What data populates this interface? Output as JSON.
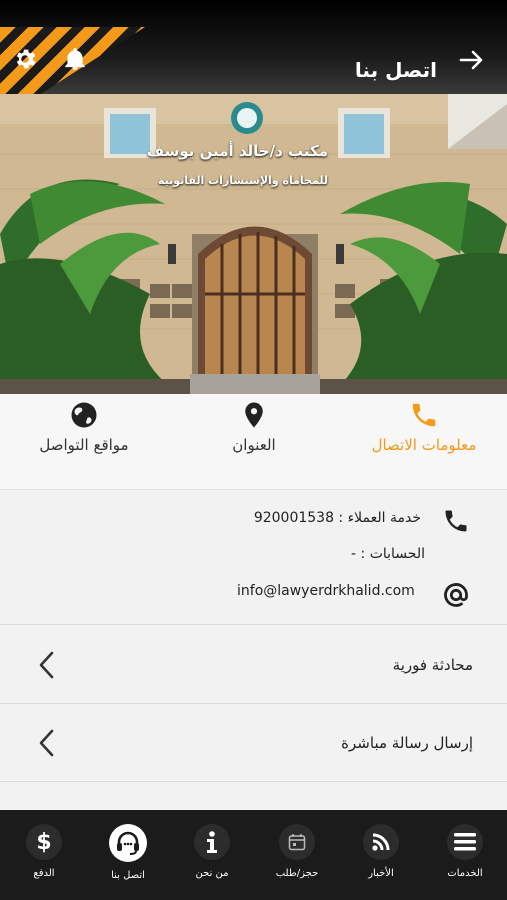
{
  "header": {
    "title": "اتصل بنا",
    "icons": [
      "settings-icon",
      "bell-icon",
      "arrow-right-icon"
    ],
    "accent": "#f39a1b"
  },
  "photo": {
    "sign_line1": "مكتب د/خالد أمين يوسف",
    "sign_line2": "للمحاماة والإستشارات القانونية"
  },
  "tabs": [
    {
      "label": "معلومات الاتصال",
      "icon": "phone-icon",
      "active": true
    },
    {
      "label": "العنوان",
      "icon": "location-pin-icon",
      "active": false
    },
    {
      "label": "مواقع التواصل",
      "icon": "globe-icon",
      "active": false
    }
  ],
  "contact": {
    "customer_service": "خدمة العملاء : 920001538",
    "accounts": "الحسابات : -",
    "email": "info@lawyerdrkhalid.com"
  },
  "actions": [
    {
      "label": "محادثة فورية",
      "icon": "chevron-left-icon"
    },
    {
      "label": "إرسال رسالة مباشرة",
      "icon": "chevron-left-icon"
    }
  ],
  "bottom_nav": [
    {
      "label": "الخدمات",
      "icon": "menu-icon"
    },
    {
      "label": "الأخبار",
      "icon": "rss-icon"
    },
    {
      "label": "حجز/طلب",
      "icon": "calendar-icon"
    },
    {
      "label": "من نحن",
      "icon": "info-icon"
    },
    {
      "label": "اتصل بنا",
      "icon": "headset-icon",
      "active": true
    },
    {
      "label": "الدفع",
      "icon": "dollar-icon"
    }
  ]
}
